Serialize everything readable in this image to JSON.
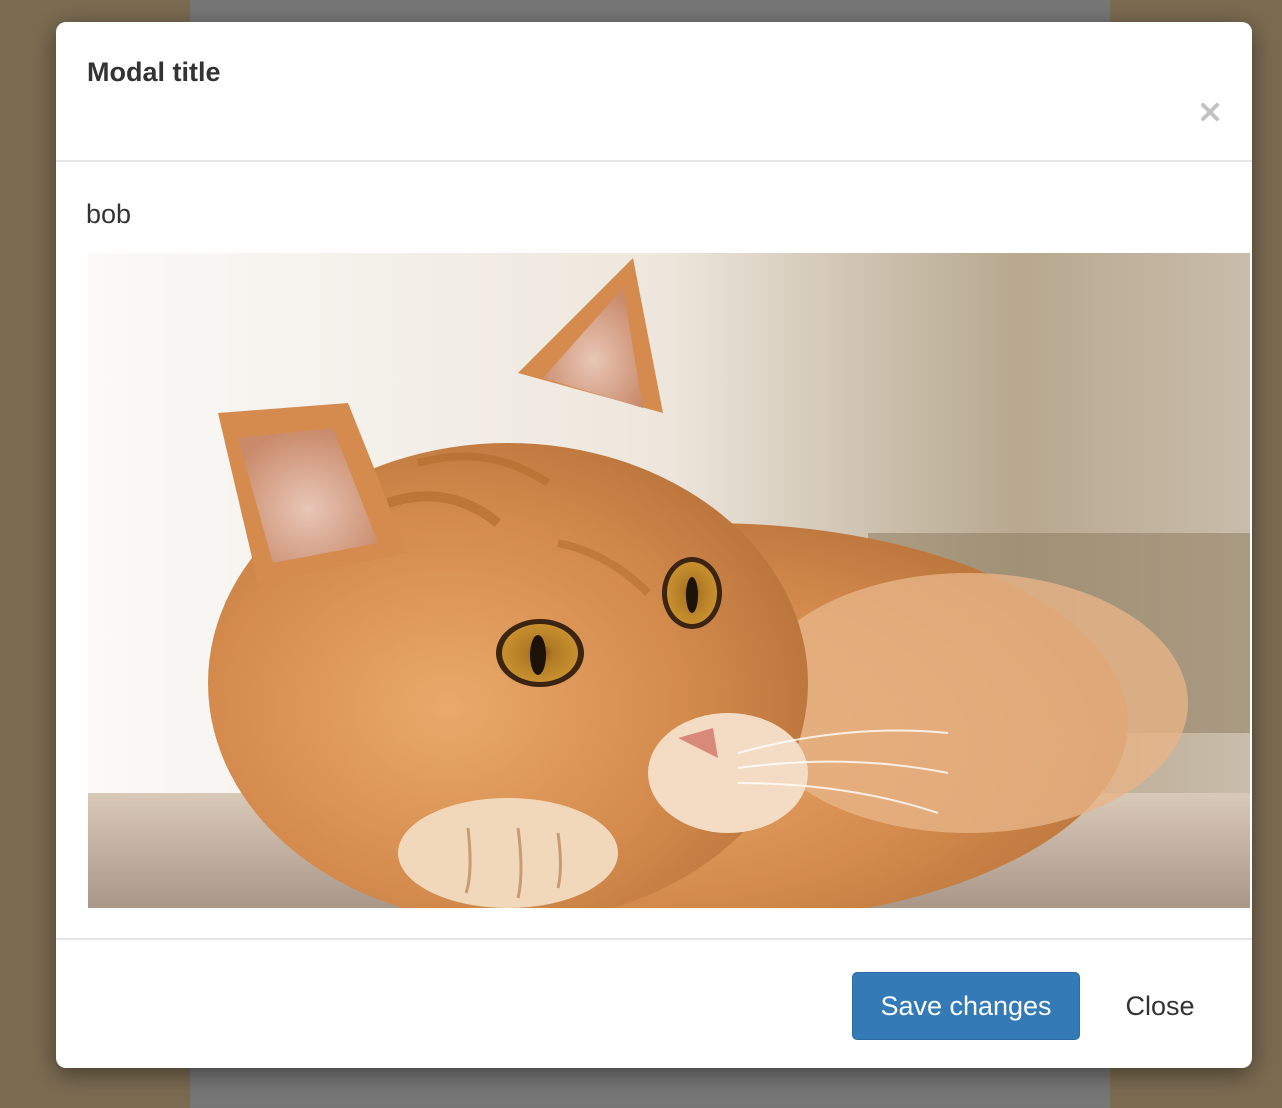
{
  "modal": {
    "title": "Modal title",
    "close_icon": "close-icon",
    "body_text": "bob",
    "image_subject": "orange tabby cat lying down",
    "save_label": "Save changes",
    "close_label": "Close"
  },
  "colors": {
    "backdrop": "#7b6b51",
    "backdrop_center": "#777777",
    "primary_button": "#337ab7",
    "text": "#333333",
    "divider": "#e5e5e5"
  }
}
